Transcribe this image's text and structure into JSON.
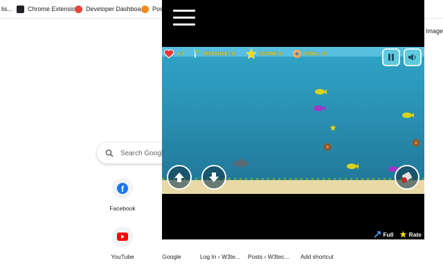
{
  "bookmarks": [
    {
      "label": "lis...",
      "color": "#3c4043"
    },
    {
      "label": "Chrome Extension",
      "color": "#202124"
    },
    {
      "label": "Developer Dashboa...",
      "color": "#e8453c"
    },
    {
      "label": "Post",
      "color": "#f28b1a"
    }
  ],
  "bookmarks_overflow": "Image",
  "search": {
    "placeholder": "Search Googl"
  },
  "shortcuts": [
    {
      "label": "Facebook"
    },
    {
      "label": "YouTube"
    },
    {
      "label": "Google"
    },
    {
      "label": "Log In ‹ W3te..."
    },
    {
      "label": "Posts ‹ W3tec..."
    },
    {
      "label": "Add shortcut"
    }
  ],
  "game": {
    "hud": {
      "lives": "x 3",
      "distance": "DISTANCE: 11",
      "score": "SCORE: 0",
      "goal": "GOAL: 10"
    }
  },
  "footer": {
    "full": "Full",
    "rate": "Rate"
  },
  "colors": {
    "accent": "#5fc9de",
    "water": "#2b93b6",
    "sand": "#e8d9a7"
  }
}
